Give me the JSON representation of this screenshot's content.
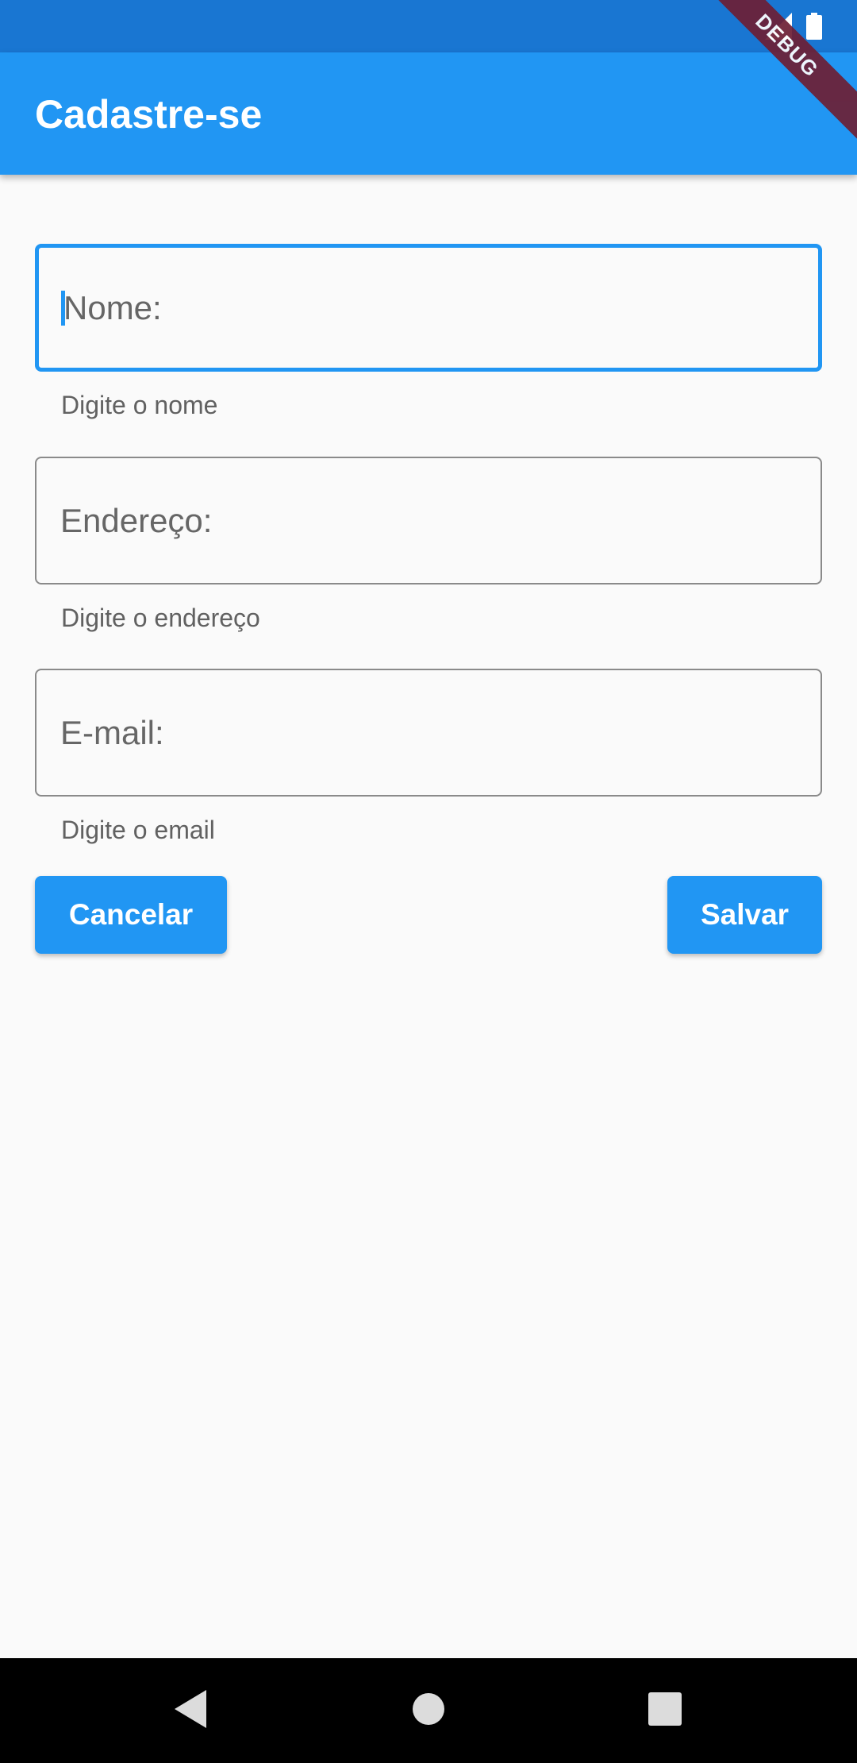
{
  "status_bar": {
    "icons": [
      "signal-icon",
      "battery-icon"
    ],
    "background": "#1976d2"
  },
  "app_bar": {
    "title": "Cadastre-se",
    "background": "#2196f3"
  },
  "debug_banner": {
    "label": "DEBUG",
    "color": "#6d1f35"
  },
  "form": {
    "fields": [
      {
        "label": "Nome:",
        "value": "",
        "helper": "Digite o nome",
        "focused": true
      },
      {
        "label": "Endereço:",
        "value": "",
        "helper": "Digite o endereço",
        "focused": false
      },
      {
        "label": "E-mail:",
        "value": "",
        "helper": "Digite o email",
        "focused": false
      }
    ],
    "accent": "#2196f3"
  },
  "buttons": {
    "cancel_label": "Cancelar",
    "save_label": "Salvar"
  },
  "nav_bar": {
    "icons": [
      "back-icon",
      "home-icon",
      "recents-icon"
    ]
  }
}
